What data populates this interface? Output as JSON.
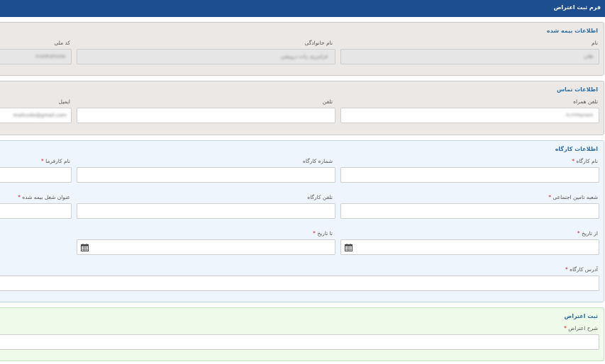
{
  "header": {
    "title": "فرم ثبت اعتراض"
  },
  "insured_section": {
    "title": "اطلاعات بیمه شده",
    "first_name": {
      "label": "نام",
      "value": "فلان"
    },
    "last_name": {
      "label": "نام خانوادگی",
      "value": "فرامرزی زاده درویشی"
    },
    "national_code": {
      "label": "کد ملی",
      "value": "۲۶۸۹۴۸۳۶۸۹۷"
    }
  },
  "contact_section": {
    "title": "اطلاعات تماس",
    "mobile": {
      "label": "تلفن همراه",
      "value": "۰۹۱۲۳۴۵۶۷۸۹"
    },
    "phone": {
      "label": "تلفن",
      "value": ""
    },
    "email": {
      "label": "ایمیل",
      "value": "mailcode@gmail.com"
    }
  },
  "workshop_section": {
    "title": "اطلاعات کارگاه",
    "workshop_name": {
      "label": "نام کارگاه",
      "required": "*"
    },
    "workshop_number": {
      "label": "شماره کارگاه"
    },
    "employer_name": {
      "label": "نام کارفرما",
      "required": "*"
    },
    "insurance_branch": {
      "label": "شعبه تامین اجتماعی",
      "required": "*"
    },
    "workshop_phone": {
      "label": "تلفن کارگاه"
    },
    "job_title": {
      "label": "عنوان شغل بیمه شده",
      "required": "*"
    },
    "from_date": {
      "label": "از تاریخ",
      "required": "*",
      "icon": "calendar-icon"
    },
    "to_date": {
      "label": "تا تاریخ",
      "required": "*",
      "icon": "calendar-icon"
    },
    "address": {
      "label": "آدرس کارگاه",
      "required": "*"
    }
  },
  "objection_section": {
    "title": "ثبت اعتراض",
    "description": {
      "label": "شرح اعتراض",
      "required": "*"
    }
  },
  "colors": {
    "header": "#1d4f8e",
    "section_title": "#2d6ea3",
    "required": "#d0202a",
    "workshop_bg": "#eef5fc",
    "objection_bg": "#eefbea"
  }
}
